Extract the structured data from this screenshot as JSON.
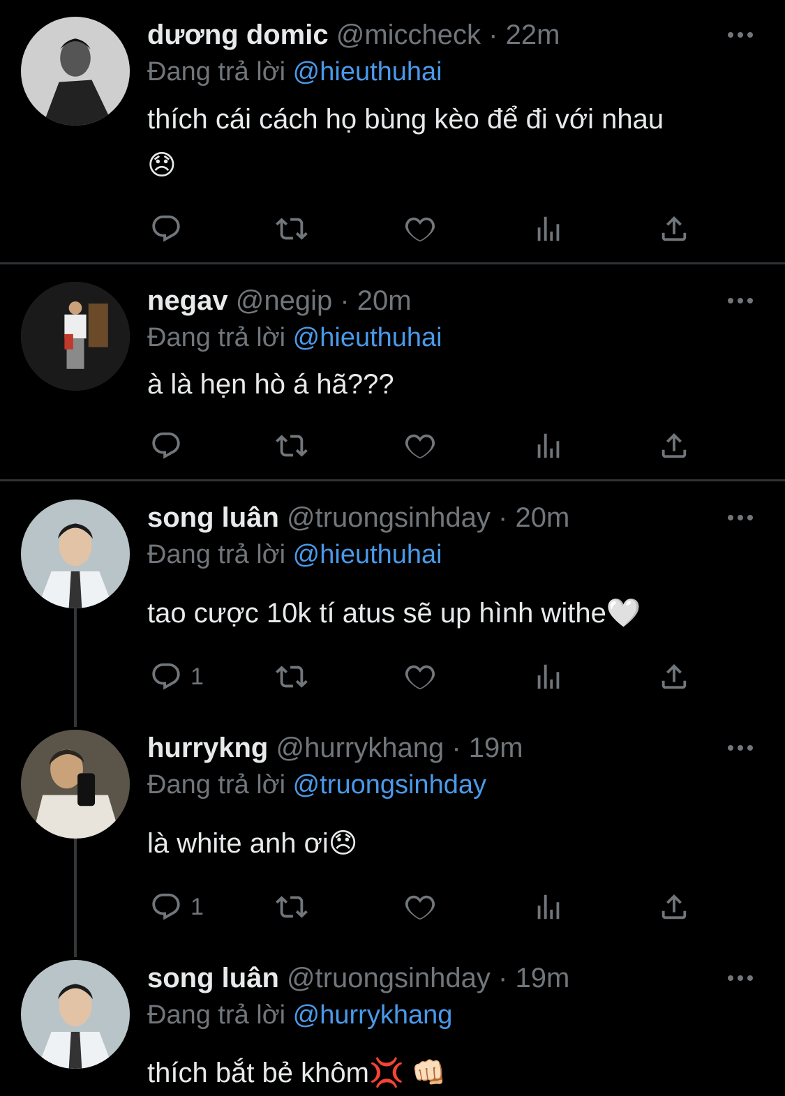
{
  "reply_prefix": "Đang trả lời",
  "tweets": [
    {
      "name": "dương domic",
      "meta": "@miccheck · 22m",
      "reply_to": "@hieuthuhai",
      "text_line1": "thích cái cách họ bùng kèo để đi với nhau",
      "text_line2": "",
      "emoji": "😞",
      "reply_count": ""
    },
    {
      "name": "negav",
      "meta": "@negip · 20m",
      "reply_to": "@hieuthuhai",
      "text_line1": "à là hẹn hò á hã???",
      "reply_count": ""
    },
    {
      "name": "song luân",
      "meta": "@truongsinhday · 20m",
      "reply_to": "@hieuthuhai",
      "text_line1": "tao cược 10k tí atus sẽ up hình withe",
      "emoji": "🤍",
      "reply_count": "1"
    },
    {
      "name": "hurrykng",
      "meta": "@hurrykhang · 19m",
      "reply_to": "@truongsinhday",
      "text_line1": "là white anh ơi",
      "emoji": "😞",
      "reply_count": "1"
    },
    {
      "name": "song luân",
      "meta": "@truongsinhday · 19m",
      "reply_to": "@hurrykhang",
      "text_line1": "thích bắt bẻ khôm",
      "emoji": "💢 👊🏻"
    }
  ],
  "icons": {
    "reply": "reply-icon",
    "retweet": "retweet-icon",
    "like": "heart-icon",
    "views": "views-icon",
    "share": "share-icon",
    "more": "more-icon"
  },
  "colors": {
    "background": "#000000",
    "mention": "#4a99e9",
    "muted": "#71767b",
    "text": "#e7e9ea"
  }
}
